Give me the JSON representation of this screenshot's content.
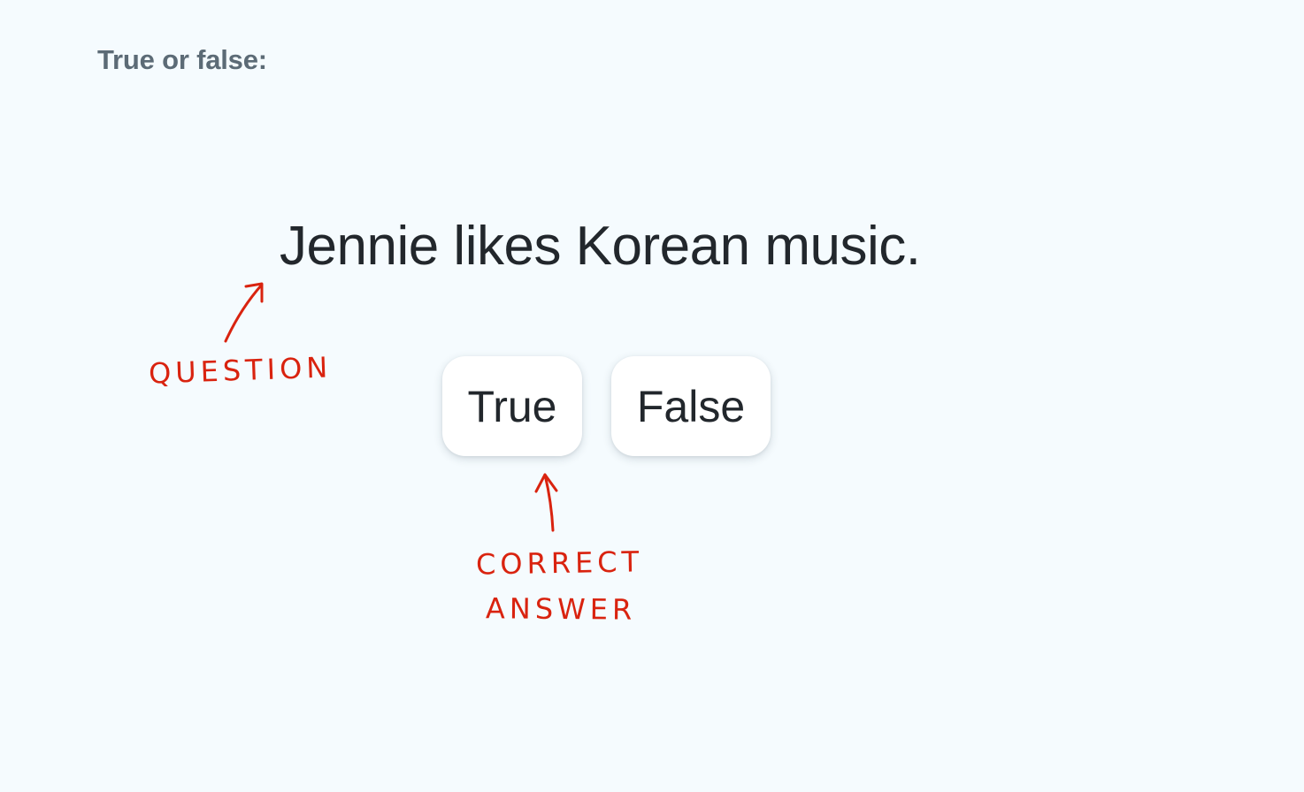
{
  "instruction": "True or false:",
  "question": "Jennie likes Korean music.",
  "options": [
    {
      "label": "True"
    },
    {
      "label": "False"
    }
  ],
  "annotations": {
    "question_label": "QUESTION",
    "correct_line1": "CORRECT",
    "correct_line2": "ANSWER",
    "color": "#d9230f"
  },
  "colors": {
    "background": "#f5fbfe",
    "instruction_text": "#5c6b76",
    "body_text": "#22272c",
    "button_bg": "#ffffff"
  }
}
